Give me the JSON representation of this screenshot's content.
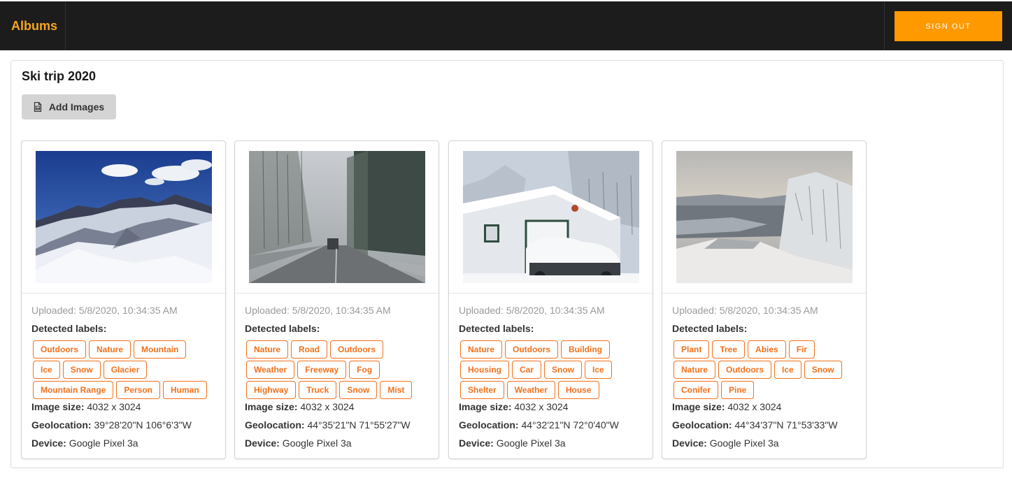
{
  "header": {
    "brand": "Albums",
    "sign_out": "SIGN OUT"
  },
  "album": {
    "title": "Ski trip 2020",
    "add_images_label": "Add Images"
  },
  "labels": {
    "detected": "Detected labels:",
    "image_size": "Image size:",
    "geolocation": "Geolocation:",
    "device": "Device:"
  },
  "cards": [
    {
      "uploaded": "Uploaded: 5/8/2020, 10:34:35 AM",
      "tags": [
        "Outdoors",
        "Nature",
        "Mountain",
        "Ice",
        "Snow",
        "Glacier",
        "Mountain Range",
        "Person",
        "Human"
      ],
      "image_size": "4032 x 3024",
      "geolocation": "39°28'20\"N  106°6'3\"W",
      "device": "Google Pixel 3a",
      "image_alt": "mountain-photo"
    },
    {
      "uploaded": "Uploaded: 5/8/2020, 10:34:35 AM",
      "tags": [
        "Nature",
        "Road",
        "Outdoors",
        "Weather",
        "Freeway",
        "Fog",
        "Highway",
        "Truck",
        "Snow",
        "Mist"
      ],
      "image_size": "4032 x 3024",
      "geolocation": "44°35'21\"N  71°55'27\"W",
      "device": "Google Pixel 3a",
      "image_alt": "foggy-road-photo"
    },
    {
      "uploaded": "Uploaded: 5/8/2020, 10:34:35 AM",
      "tags": [
        "Nature",
        "Outdoors",
        "Building",
        "Housing",
        "Car",
        "Snow",
        "Ice",
        "Shelter",
        "Weather",
        "House"
      ],
      "image_size": "4032 x 3024",
      "geolocation": "44°32'21\"N  72°0'40\"W",
      "device": "Google Pixel 3a",
      "image_alt": "snowy-garage-photo"
    },
    {
      "uploaded": "Uploaded: 5/8/2020, 10:34:35 AM",
      "tags": [
        "Plant",
        "Tree",
        "Abies",
        "Fir",
        "Nature",
        "Outdoors",
        "Ice",
        "Snow",
        "Conifer",
        "Pine"
      ],
      "image_size": "4032 x 3024",
      "geolocation": "44°34'37\"N  71°53'33\"W",
      "device": "Google Pixel 3a",
      "image_alt": "ski-slope-photo"
    }
  ],
  "colors": {
    "accent": "#ff9900",
    "tag": "#f2711c",
    "brand": "#f5a623",
    "topbar": "#1c1c1c"
  }
}
